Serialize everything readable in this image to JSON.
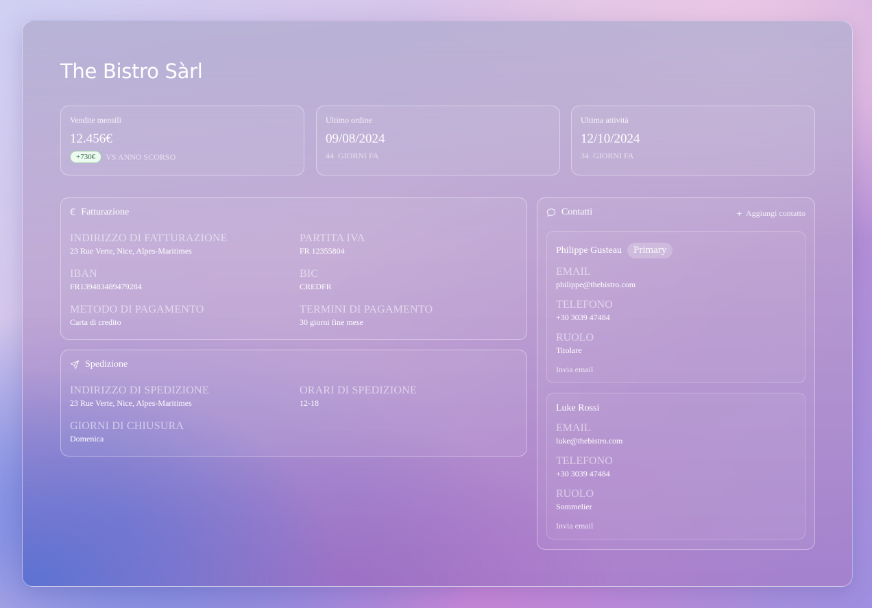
{
  "company": {
    "name": "The Bistro Sàrl"
  },
  "stats": [
    {
      "label": "Vendite mensili",
      "value": "12.456€",
      "badge": "+730€",
      "sub": "VS ANNO SCORSO"
    },
    {
      "label": "Ultimo ordine",
      "value": "09/08/2024",
      "days": "44",
      "sub": "GIORNI FA"
    },
    {
      "label": "Ultima attività",
      "value": "12/10/2024",
      "days": "34",
      "sub": "GIORNI FA"
    }
  ],
  "billing": {
    "title": "Fatturazione",
    "icon": "euro-icon",
    "fields": [
      {
        "label": "INDIRIZZO DI FATTURAZIONE",
        "value": "23 Rue Verte, Nice, Alpes-Maritimes"
      },
      {
        "label": "PARTITA IVA",
        "value": "FR 12355804"
      },
      {
        "label": "IBAN",
        "value": "FR139483489479284"
      },
      {
        "label": "BIC",
        "value": "CREDFR"
      },
      {
        "label": "METODO DI PAGAMENTO",
        "value": "Carta di credito"
      },
      {
        "label": "TERMINI DI PAGAMENTO",
        "value": "30 giorni fine mese"
      }
    ]
  },
  "shipping": {
    "title": "Spedizione",
    "icon": "send-icon",
    "fields": [
      {
        "label": "INDIRIZZO DI SPEDIZIONE",
        "value": "23 Rue Verte, Nice, Alpes-Maritimes"
      },
      {
        "label": "ORARI DI SPEDIZIONE",
        "value": "12-18"
      },
      {
        "label": "GIORNI DI CHIUSURA",
        "value": "Domenica"
      }
    ]
  },
  "contacts": {
    "title": "Contatti",
    "icon": "chat-bubble-icon",
    "add_label": "Aggiungi contatto",
    "list": [
      {
        "name": "Philippe Gusteau",
        "badge": "Primary",
        "email_label": "EMAIL",
        "email": "philippe@thebistro.com",
        "phone_label": "TELEFONO",
        "phone": "+30 3039 47484",
        "role_label": "RUOLO",
        "role": "Titolare",
        "action": "Invia email"
      },
      {
        "name": "Luke Rossi",
        "email_label": "EMAIL",
        "email": "luke@thebistro.com",
        "phone_label": "TELEFONO",
        "phone": "+30 3039 47484",
        "role_label": "RUOLO",
        "role": "Sommelier",
        "action": "Invia email"
      }
    ]
  }
}
